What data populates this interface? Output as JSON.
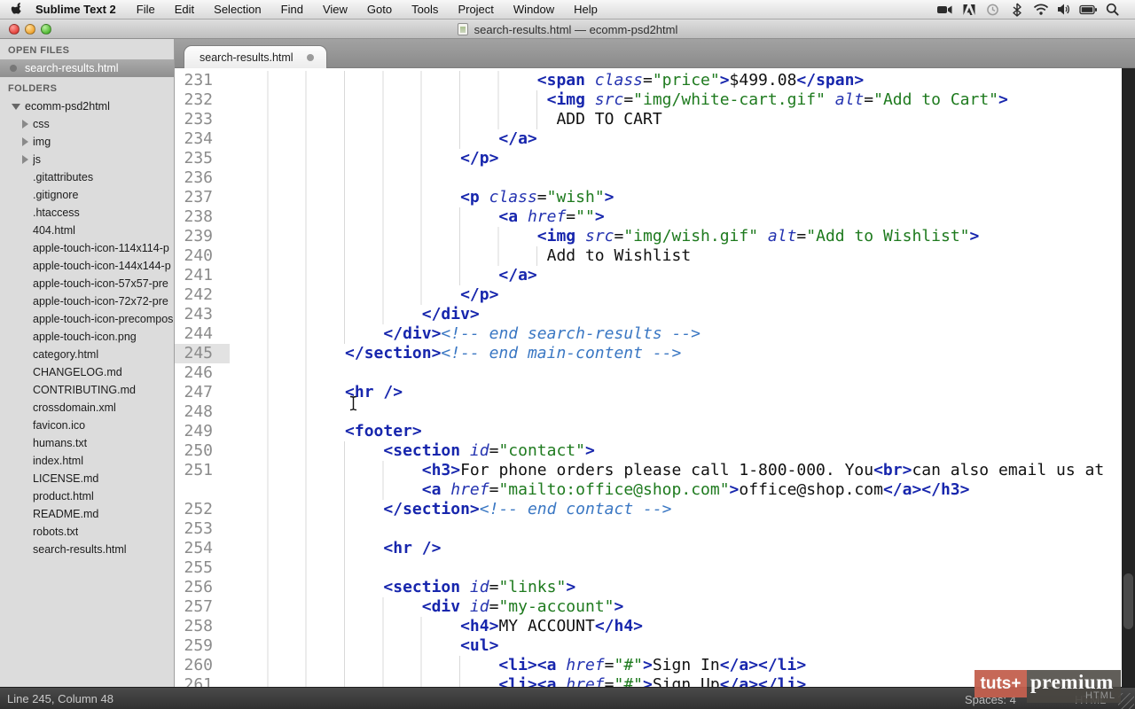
{
  "menubar": {
    "app_name": "Sublime Text 2",
    "items": [
      "File",
      "Edit",
      "Selection",
      "Find",
      "View",
      "Goto",
      "Tools",
      "Project",
      "Window",
      "Help"
    ],
    "status_icons": [
      "screen-recording",
      "adobe",
      "time-machine",
      "bluetooth",
      "wifi",
      "volume",
      "battery",
      "spotlight"
    ]
  },
  "titlebar": {
    "title": "search-results.html — ecomm-psd2html"
  },
  "sidebar": {
    "open_files_header": "OPEN FILES",
    "open_file": {
      "name": "search-results.html",
      "dirty": true
    },
    "folders_header": "FOLDERS",
    "tree": [
      {
        "label": "ecomm-psd2html",
        "type": "folder-open",
        "level": 0
      },
      {
        "label": "css",
        "type": "folder",
        "level": 1
      },
      {
        "label": "img",
        "type": "folder",
        "level": 1
      },
      {
        "label": "js",
        "type": "folder",
        "level": 1
      },
      {
        "label": ".gitattributes",
        "type": "file",
        "level": 1
      },
      {
        "label": ".gitignore",
        "type": "file",
        "level": 1
      },
      {
        "label": ".htaccess",
        "type": "file",
        "level": 1
      },
      {
        "label": "404.html",
        "type": "file",
        "level": 1
      },
      {
        "label": "apple-touch-icon-114x114-p",
        "type": "file",
        "level": 1
      },
      {
        "label": "apple-touch-icon-144x144-p",
        "type": "file",
        "level": 1
      },
      {
        "label": "apple-touch-icon-57x57-pre",
        "type": "file",
        "level": 1
      },
      {
        "label": "apple-touch-icon-72x72-pre",
        "type": "file",
        "level": 1
      },
      {
        "label": "apple-touch-icon-precompos",
        "type": "file",
        "level": 1
      },
      {
        "label": "apple-touch-icon.png",
        "type": "file",
        "level": 1
      },
      {
        "label": "category.html",
        "type": "file",
        "level": 1
      },
      {
        "label": "CHANGELOG.md",
        "type": "file",
        "level": 1
      },
      {
        "label": "CONTRIBUTING.md",
        "type": "file",
        "level": 1
      },
      {
        "label": "crossdomain.xml",
        "type": "file",
        "level": 1
      },
      {
        "label": "favicon.ico",
        "type": "file",
        "level": 1
      },
      {
        "label": "humans.txt",
        "type": "file",
        "level": 1
      },
      {
        "label": "index.html",
        "type": "file",
        "level": 1
      },
      {
        "label": "LICENSE.md",
        "type": "file",
        "level": 1
      },
      {
        "label": "product.html",
        "type": "file",
        "level": 1
      },
      {
        "label": "README.md",
        "type": "file",
        "level": 1
      },
      {
        "label": "robots.txt",
        "type": "file",
        "level": 1
      },
      {
        "label": "search-results.html",
        "type": "file",
        "level": 1
      }
    ]
  },
  "tabbar": {
    "active_tab": {
      "label": "search-results.html",
      "dirty": true
    }
  },
  "editor": {
    "rows": [
      {
        "n": "231",
        "i": 32,
        "seg": [
          [
            "t",
            "<span"
          ],
          [
            "a",
            " class"
          ],
          [
            "p",
            "="
          ],
          [
            "s",
            "\"price\""
          ],
          [
            "t",
            ">"
          ],
          [
            "x",
            "$499.08"
          ],
          [
            "t",
            "</span>"
          ]
        ]
      },
      {
        "n": "232",
        "i": 33,
        "seg": [
          [
            "t",
            "<img"
          ],
          [
            "a",
            " src"
          ],
          [
            "p",
            "="
          ],
          [
            "s",
            "\"img/white-cart.gif\""
          ],
          [
            "a",
            " alt"
          ],
          [
            "p",
            "="
          ],
          [
            "s",
            "\"Add to Cart\""
          ],
          [
            "t",
            ">"
          ]
        ]
      },
      {
        "n": "233",
        "i": 34,
        "seg": [
          [
            "x",
            "ADD TO CART"
          ]
        ]
      },
      {
        "n": "234",
        "i": 28,
        "seg": [
          [
            "t",
            "</a>"
          ]
        ]
      },
      {
        "n": "235",
        "i": 24,
        "seg": [
          [
            "t",
            "</p>"
          ]
        ]
      },
      {
        "n": "236",
        "i": 24,
        "seg": []
      },
      {
        "n": "237",
        "i": 24,
        "seg": [
          [
            "t",
            "<p"
          ],
          [
            "a",
            " class"
          ],
          [
            "p",
            "="
          ],
          [
            "s",
            "\"wish\""
          ],
          [
            "t",
            ">"
          ]
        ]
      },
      {
        "n": "238",
        "i": 28,
        "seg": [
          [
            "t",
            "<a"
          ],
          [
            "a",
            " href"
          ],
          [
            "p",
            "="
          ],
          [
            "s",
            "\"\""
          ],
          [
            "t",
            ">"
          ]
        ]
      },
      {
        "n": "239",
        "i": 32,
        "seg": [
          [
            "t",
            "<img"
          ],
          [
            "a",
            " src"
          ],
          [
            "p",
            "="
          ],
          [
            "s",
            "\"img/wish.gif\""
          ],
          [
            "a",
            " alt"
          ],
          [
            "p",
            "="
          ],
          [
            "s",
            "\"Add to Wishlist\""
          ],
          [
            "t",
            ">"
          ]
        ]
      },
      {
        "n": "240",
        "i": 33,
        "seg": [
          [
            "x",
            "Add to Wishlist"
          ]
        ]
      },
      {
        "n": "241",
        "i": 28,
        "seg": [
          [
            "t",
            "</a>"
          ]
        ]
      },
      {
        "n": "242",
        "i": 24,
        "seg": [
          [
            "t",
            "</p>"
          ]
        ]
      },
      {
        "n": "243",
        "i": 20,
        "seg": [
          [
            "t",
            "</div>"
          ]
        ]
      },
      {
        "n": "244",
        "i": 16,
        "seg": [
          [
            "t",
            "</div>"
          ],
          [
            "c",
            "<!-- end search-results -->"
          ]
        ]
      },
      {
        "n": "245",
        "i": 12,
        "active": true,
        "seg": [
          [
            "t",
            "</section>"
          ],
          [
            "c",
            "<!-- end main-content -->"
          ]
        ]
      },
      {
        "n": "246",
        "i": 12,
        "seg": []
      },
      {
        "n": "247",
        "i": 12,
        "seg": [
          [
            "t",
            "<hr />"
          ]
        ]
      },
      {
        "n": "248",
        "i": 12,
        "seg": []
      },
      {
        "n": "249",
        "i": 12,
        "seg": [
          [
            "t",
            "<footer>"
          ]
        ]
      },
      {
        "n": "250",
        "i": 16,
        "seg": [
          [
            "t",
            "<section"
          ],
          [
            "a",
            " id"
          ],
          [
            "p",
            "="
          ],
          [
            "s",
            "\"contact\""
          ],
          [
            "t",
            ">"
          ]
        ]
      },
      {
        "n": "251",
        "i": 20,
        "seg": [
          [
            "t",
            "<h3>"
          ],
          [
            "x",
            "For phone orders please call 1-800-000. You"
          ],
          [
            "t",
            "<br>"
          ],
          [
            "x",
            "can also email us at"
          ]
        ]
      },
      {
        "n": "",
        "i": 20,
        "seg": [
          [
            "t",
            "<a"
          ],
          [
            "a",
            " href"
          ],
          [
            "p",
            "="
          ],
          [
            "s",
            "\"mailto:office@shop.com\""
          ],
          [
            "t",
            ">"
          ],
          [
            "x",
            "office@shop.com"
          ],
          [
            "t",
            "</a></h3>"
          ]
        ]
      },
      {
        "n": "252",
        "i": 16,
        "seg": [
          [
            "t",
            "</section>"
          ],
          [
            "c",
            "<!-- end contact -->"
          ]
        ]
      },
      {
        "n": "253",
        "i": 16,
        "seg": []
      },
      {
        "n": "254",
        "i": 16,
        "seg": [
          [
            "t",
            "<hr />"
          ]
        ]
      },
      {
        "n": "255",
        "i": 16,
        "seg": []
      },
      {
        "n": "256",
        "i": 16,
        "seg": [
          [
            "t",
            "<section"
          ],
          [
            "a",
            " id"
          ],
          [
            "p",
            "="
          ],
          [
            "s",
            "\"links\""
          ],
          [
            "t",
            ">"
          ]
        ]
      },
      {
        "n": "257",
        "i": 20,
        "seg": [
          [
            "t",
            "<div"
          ],
          [
            "a",
            " id"
          ],
          [
            "p",
            "="
          ],
          [
            "s",
            "\"my-account\""
          ],
          [
            "t",
            ">"
          ]
        ]
      },
      {
        "n": "258",
        "i": 24,
        "seg": [
          [
            "t",
            "<h4>"
          ],
          [
            "x",
            "MY ACCOUNT"
          ],
          [
            "t",
            "</h4>"
          ]
        ]
      },
      {
        "n": "259",
        "i": 24,
        "seg": [
          [
            "t",
            "<ul>"
          ]
        ]
      },
      {
        "n": "260",
        "i": 28,
        "seg": [
          [
            "t",
            "<li><a"
          ],
          [
            "a",
            " href"
          ],
          [
            "p",
            "="
          ],
          [
            "s",
            "\"#\""
          ],
          [
            "t",
            ">"
          ],
          [
            "x",
            "Sign In"
          ],
          [
            "t",
            "</a></li>"
          ]
        ]
      },
      {
        "n": "261",
        "i": 28,
        "seg": [
          [
            "t",
            "<li><a"
          ],
          [
            "a",
            " href"
          ],
          [
            "p",
            "="
          ],
          [
            "s",
            "\"#\""
          ],
          [
            "t",
            ">"
          ],
          [
            "x",
            "Sign Up"
          ],
          [
            "t",
            "</a></li>"
          ]
        ]
      }
    ]
  },
  "statusbar": {
    "position": "Line 245, Column 48",
    "spaces": "Spaces: 4",
    "syntax": "HTML"
  },
  "watermark": {
    "brand": "tuts+",
    "tier": "premium",
    "sub": "HTML"
  },
  "colors": {
    "tag": "#1726ad",
    "attr": "#2433b0",
    "string": "#1e7a1e",
    "comment": "#3a77c3",
    "watermark_red": "#c4604f"
  }
}
